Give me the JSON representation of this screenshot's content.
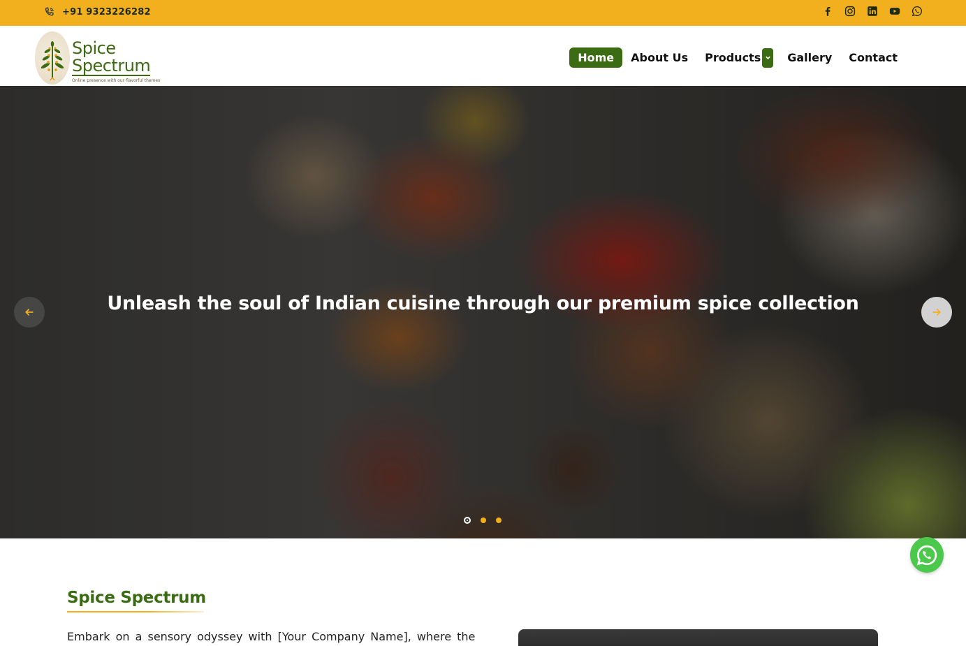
{
  "topbar": {
    "phone": "+91 9323226282",
    "background": "#f2b01e",
    "socials": [
      "facebook-icon",
      "instagram-icon",
      "linkedin-icon",
      "youtube-icon",
      "whatsapp-icon"
    ]
  },
  "logo": {
    "line1": "Spice",
    "line2": "Spectrum",
    "tagline": "Online presence with our flavorful themes"
  },
  "nav": {
    "items": [
      {
        "label": "Home",
        "active": true
      },
      {
        "label": "About Us"
      },
      {
        "label": "Products",
        "has_dropdown": true
      },
      {
        "label": "Gallery"
      },
      {
        "label": "Contact"
      }
    ],
    "accent": "#3b6b13"
  },
  "hero": {
    "headline": "Unleash the soul of Indian cuisine through our premium spice collection",
    "slides_total": 3,
    "active_slide": 1
  },
  "about": {
    "title": "Spice Spectrum",
    "text": "Embark on a sensory odyssey with [Your Company Name], where the"
  },
  "colors": {
    "brand_green": "#3b6b13",
    "brand_yellow": "#f2b01e",
    "whatsapp_green": "#4cc94c"
  }
}
